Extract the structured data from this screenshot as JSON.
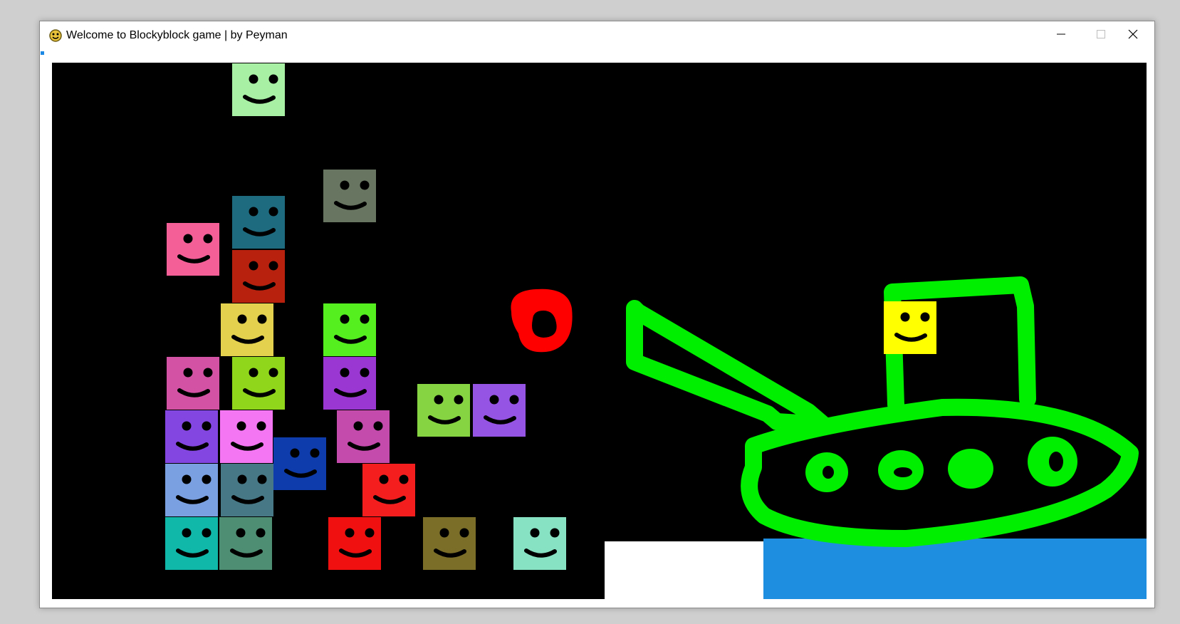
{
  "window": {
    "title": "Welcome to Blockyblock game | by Peyman",
    "app_icon": "python-snake-icon",
    "controls": [
      "minimize-icon",
      "maximize-icon",
      "close-icon"
    ]
  },
  "colors": {
    "canvas_background": "#000000",
    "ship_outline": "#00ee00",
    "water": "#1e8fe0",
    "ground": "#ffffff",
    "ball": "#ff0000",
    "face_features": "#000000"
  },
  "blocks": [
    {
      "color": "#a8f0a4"
    },
    {
      "color": "#687560"
    },
    {
      "color": "#1e6a7e"
    },
    {
      "color": "#f45f98"
    },
    {
      "color": "#b8210e"
    },
    {
      "color": "#e4d24e"
    },
    {
      "color": "#55ee1e"
    },
    {
      "color": "#d452a4"
    },
    {
      "color": "#90d61a"
    },
    {
      "color": "#9a36d2"
    },
    {
      "color": "#86d442"
    },
    {
      "color": "#9654e4"
    },
    {
      "color": "#8446e0"
    },
    {
      "color": "#f476f2"
    },
    {
      "color": "#0e3cac"
    },
    {
      "color": "#c44aac"
    },
    {
      "color": "#7aa0e2"
    },
    {
      "color": "#467886"
    },
    {
      "color": "#f41e1e"
    },
    {
      "color": "#10b8aa"
    },
    {
      "color": "#4e8e72"
    },
    {
      "color": "#f01010"
    },
    {
      "color": "#7a6e28"
    },
    {
      "color": "#86e2c2"
    },
    {
      "color": "#ffff00"
    }
  ]
}
